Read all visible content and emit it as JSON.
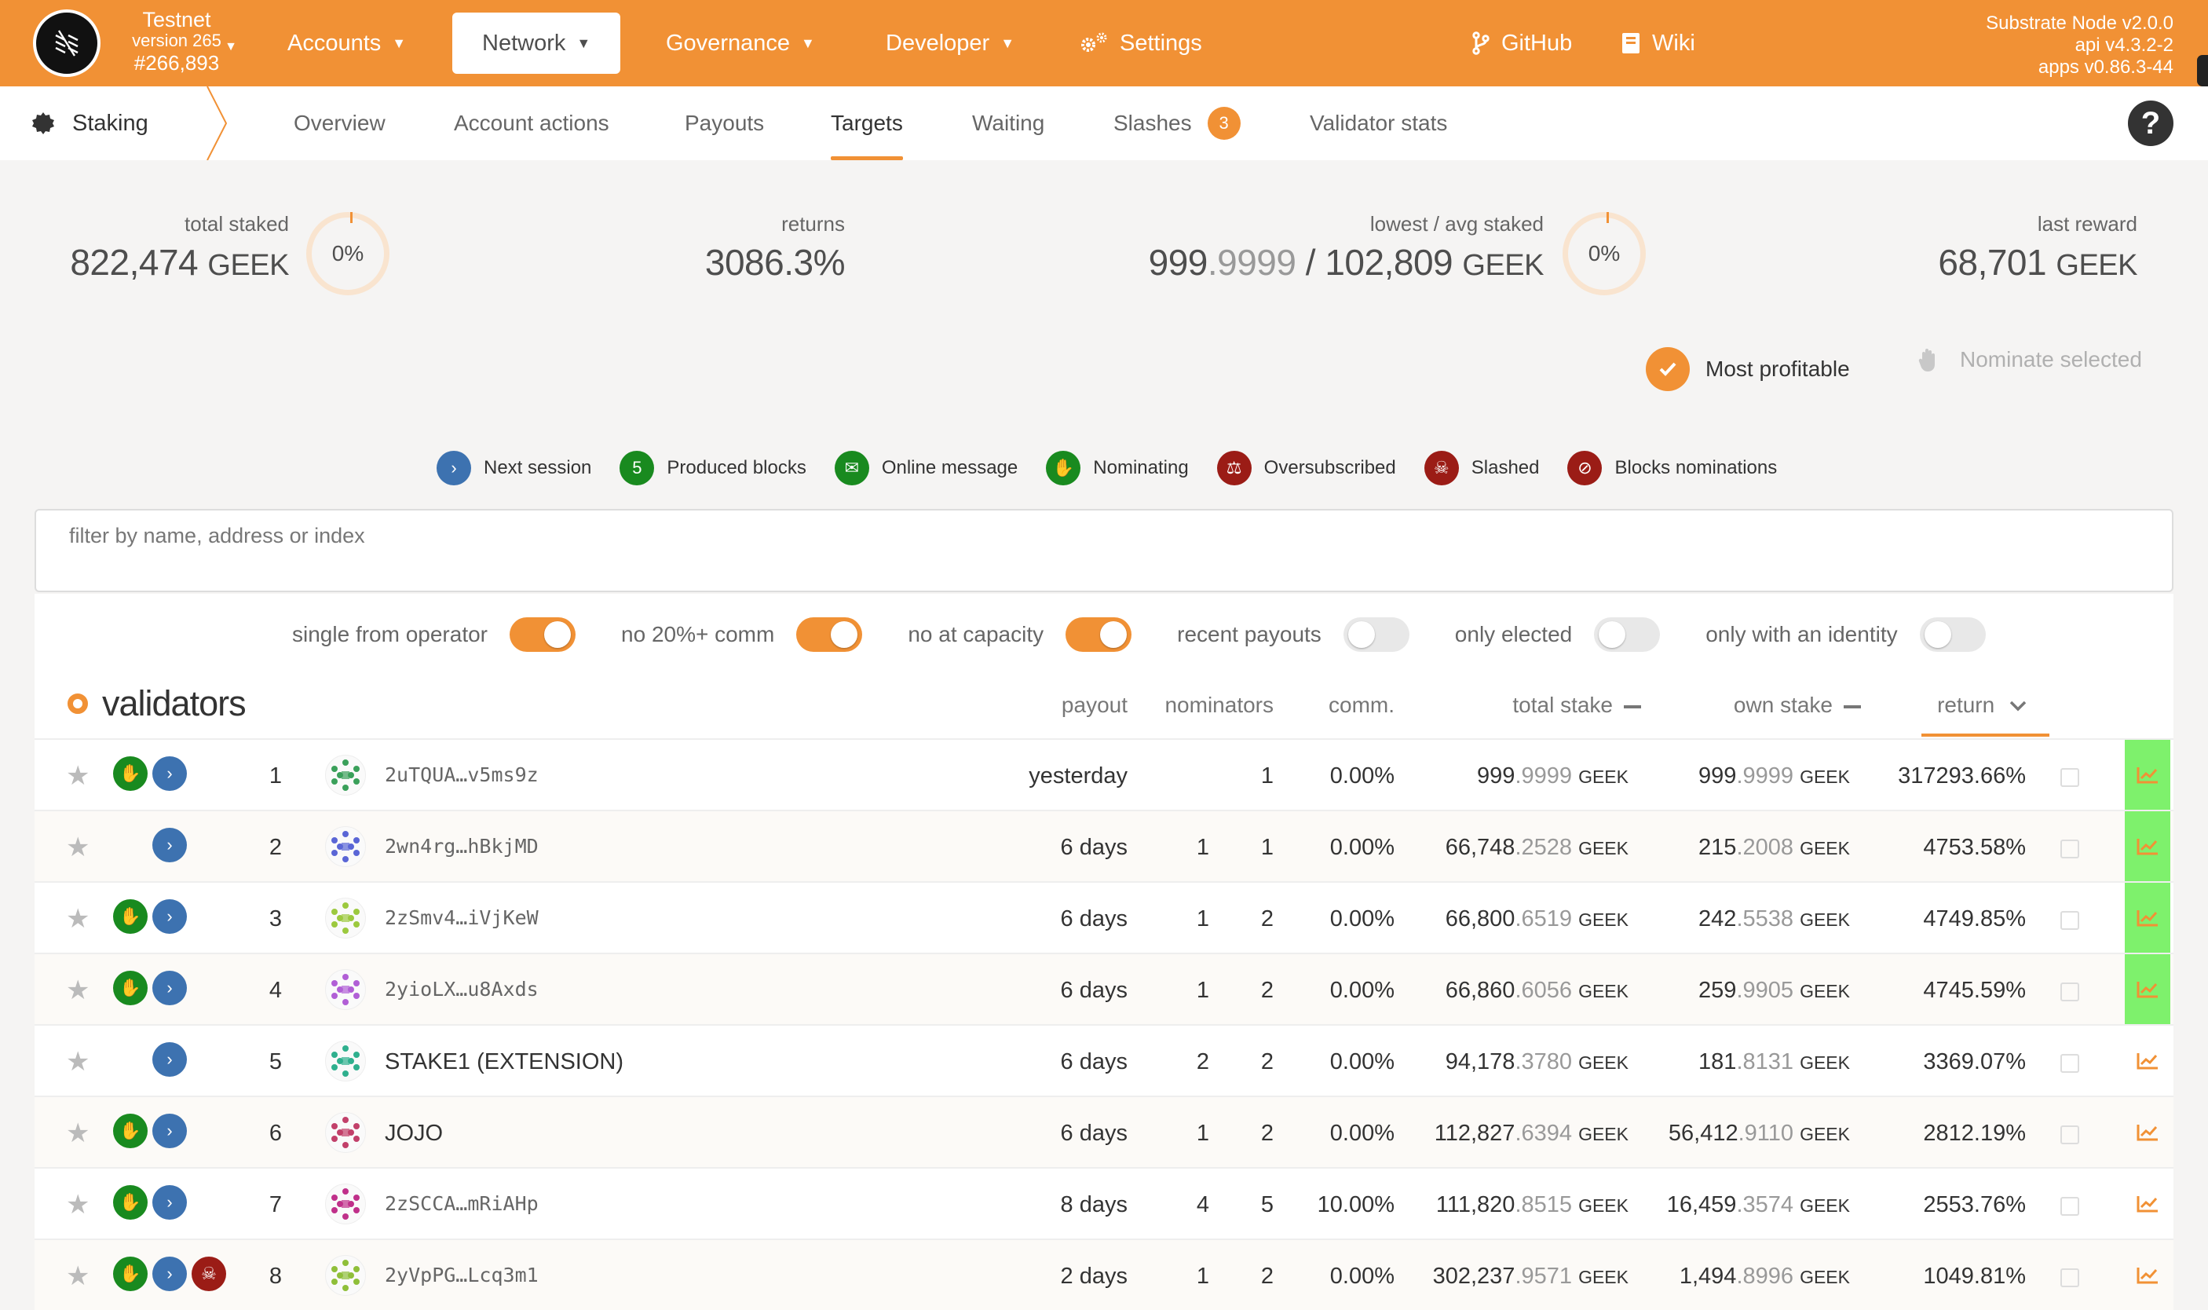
{
  "header": {
    "chain_name": "Testnet",
    "chain_version": "version 265",
    "block_number": "#266,893",
    "nav": [
      {
        "label": "Accounts"
      },
      {
        "label": "Network"
      },
      {
        "label": "Governance"
      },
      {
        "label": "Developer"
      },
      {
        "label": "Settings"
      },
      {
        "label": "GitHub"
      },
      {
        "label": "Wiki"
      }
    ],
    "node_info": [
      "Substrate Node v2.0.0",
      "api v4.3.2-2",
      "apps v0.86.3-44"
    ]
  },
  "subnav": {
    "section": "Staking",
    "tabs": [
      {
        "label": "Overview"
      },
      {
        "label": "Account actions"
      },
      {
        "label": "Payouts"
      },
      {
        "label": "Targets"
      },
      {
        "label": "Waiting"
      },
      {
        "label": "Slashes",
        "badge": "3"
      },
      {
        "label": "Validator stats"
      }
    ],
    "active_tab": "Targets",
    "help": "?"
  },
  "summary": {
    "total_staked": {
      "label": "total staked",
      "value": "822,474",
      "unit": "GEEK",
      "percent": "0%"
    },
    "returns": {
      "label": "returns",
      "value": "3086.3%"
    },
    "lowest_avg": {
      "label": "lowest / avg staked",
      "low_int": "999",
      "low_dec": ".9999",
      "sep": " / ",
      "avg": "102,809",
      "unit": "GEEK",
      "percent": "0%"
    },
    "last_reward": {
      "label": "last reward",
      "value": "68,701",
      "unit": "GEEK"
    }
  },
  "actions": {
    "most_profitable": "Most profitable",
    "nominate_selected": "Nominate selected"
  },
  "legend": [
    {
      "icon": "chevron-right-icon",
      "symbol": "›",
      "label": "Next session"
    },
    {
      "icon": "produced-blocks-icon",
      "symbol": "5",
      "label": "Produced blocks"
    },
    {
      "icon": "envelope-icon",
      "symbol": "✉",
      "label": "Online message"
    },
    {
      "icon": "hand-icon",
      "symbol": "✋",
      "label": "Nominating"
    },
    {
      "icon": "balance-scale-icon",
      "symbol": "⚖",
      "label": "Oversubscribed"
    },
    {
      "icon": "skull-icon",
      "symbol": "☠",
      "label": "Slashed"
    },
    {
      "icon": "user-slash-icon",
      "symbol": "⊘",
      "label": "Blocks nominations"
    }
  ],
  "filter": {
    "placeholder": "filter by name, address or index",
    "value": ""
  },
  "toggles": [
    {
      "label": "single from operator",
      "on": true
    },
    {
      "label": "no 20%+ comm",
      "on": true
    },
    {
      "label": "no at capacity",
      "on": true
    },
    {
      "label": "recent payouts",
      "on": false
    },
    {
      "label": "only elected",
      "on": false
    },
    {
      "label": "only with an identity",
      "on": false
    }
  ],
  "table": {
    "title": "validators",
    "columns": {
      "payout": "payout",
      "nominators": "nominators",
      "comm": "comm.",
      "total_stake": "total stake",
      "own_stake": "own stake",
      "return": "return"
    },
    "rows": [
      {
        "index": "1",
        "name": "2uTQUA…v5ms9z",
        "identity": false,
        "nominating": true,
        "next_session": true,
        "slashed": false,
        "payout": "yesterday",
        "nom_a": "",
        "nom_b": "1",
        "comm": "0.00%",
        "total_int": "999",
        "total_dec": ".9999",
        "own_int": "999",
        "own_dec": ".9999",
        "unit": "GEEK",
        "return": "317293.66%",
        "highlight": true,
        "avatar_color": "#3aa05a"
      },
      {
        "index": "2",
        "name": "2wn4rg…hBkjMD",
        "identity": false,
        "nominating": false,
        "next_session": true,
        "slashed": false,
        "payout": "6 days",
        "nom_a": "1",
        "nom_b": "1",
        "comm": "0.00%",
        "total_int": "66,748",
        "total_dec": ".2528",
        "own_int": "215",
        "own_dec": ".2008",
        "unit": "GEEK",
        "return": "4753.58%",
        "highlight": true,
        "avatar_color": "#5a66d6"
      },
      {
        "index": "3",
        "name": "2zSmv4…iVjKeW",
        "identity": false,
        "nominating": true,
        "next_session": true,
        "slashed": false,
        "payout": "6 days",
        "nom_a": "1",
        "nom_b": "2",
        "comm": "0.00%",
        "total_int": "66,800",
        "total_dec": ".6519",
        "own_int": "242",
        "own_dec": ".5538",
        "unit": "GEEK",
        "return": "4749.85%",
        "highlight": true,
        "avatar_color": "#9cc93e"
      },
      {
        "index": "4",
        "name": "2yioLX…u8Axds",
        "identity": false,
        "nominating": true,
        "next_session": true,
        "slashed": false,
        "payout": "6 days",
        "nom_a": "1",
        "nom_b": "2",
        "comm": "0.00%",
        "total_int": "66,860",
        "total_dec": ".6056",
        "own_int": "259",
        "own_dec": ".9905",
        "unit": "GEEK",
        "return": "4745.59%",
        "highlight": true,
        "avatar_color": "#b15fd6"
      },
      {
        "index": "5",
        "name": "STAKE1 (EXTENSION)",
        "identity": true,
        "nominating": false,
        "next_session": true,
        "slashed": false,
        "payout": "6 days",
        "nom_a": "2",
        "nom_b": "2",
        "comm": "0.00%",
        "total_int": "94,178",
        "total_dec": ".3780",
        "own_int": "181",
        "own_dec": ".8131",
        "unit": "GEEK",
        "return": "3369.07%",
        "highlight": false,
        "avatar_color": "#2fb08e"
      },
      {
        "index": "6",
        "name": "JOJO",
        "identity": true,
        "nominating": true,
        "next_session": true,
        "slashed": false,
        "payout": "6 days",
        "nom_a": "1",
        "nom_b": "2",
        "comm": "0.00%",
        "total_int": "112,827",
        "total_dec": ".6394",
        "own_int": "56,412",
        "own_dec": ".9110",
        "unit": "GEEK",
        "return": "2812.19%",
        "highlight": false,
        "avatar_color": "#c2406a"
      },
      {
        "index": "7",
        "name": "2zSCCA…mRiAHp",
        "identity": false,
        "nominating": true,
        "next_session": true,
        "slashed": false,
        "payout": "8 days",
        "nom_a": "4",
        "nom_b": "5",
        "comm": "10.00%",
        "total_int": "111,820",
        "total_dec": ".8515",
        "own_int": "16,459",
        "own_dec": ".3574",
        "unit": "GEEK",
        "return": "2553.76%",
        "highlight": false,
        "avatar_color": "#c0308a"
      },
      {
        "index": "8",
        "name": "2yVpPG…Lcq3m1",
        "identity": false,
        "nominating": true,
        "next_session": true,
        "slashed": true,
        "payout": "2 days",
        "nom_a": "1",
        "nom_b": "2",
        "comm": "0.00%",
        "total_int": "302,237",
        "total_dec": ".9571",
        "own_int": "1,494",
        "own_dec": ".8996",
        "unit": "GEEK",
        "return": "1049.81%",
        "highlight": false,
        "avatar_color": "#8fbf3a"
      }
    ]
  },
  "colors": {
    "accent": "#f19135",
    "highlight": "#7ef16c",
    "green": "#198a1f",
    "blue": "#3d72b0",
    "red": "#9b1c16"
  }
}
